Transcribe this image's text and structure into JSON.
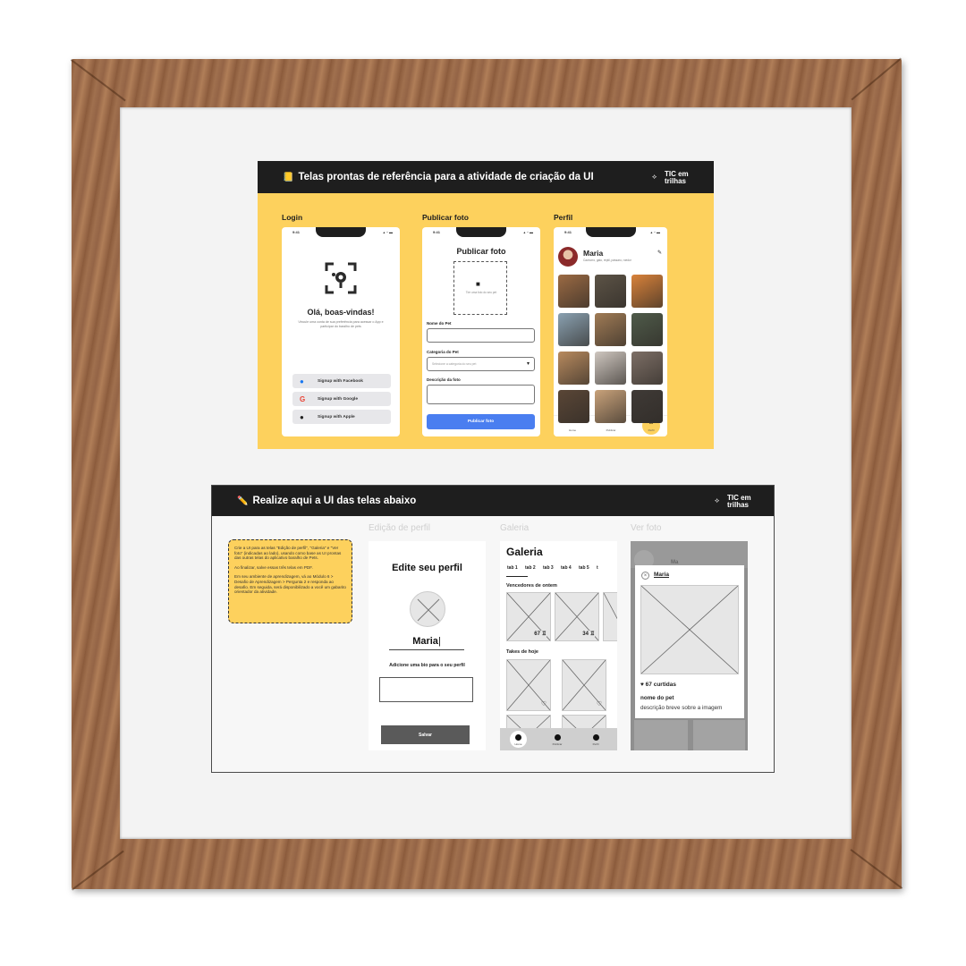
{
  "reference_panel": {
    "title": "Telas prontas de referência para a atividade de criação da UI",
    "title_icon": "📒",
    "brand": [
      "TIC em",
      "trilhas"
    ],
    "colors": {
      "accent": "#fdd15d",
      "header": "#1e1e1e",
      "primary_button": "#4a7ef0"
    },
    "screens": {
      "login": {
        "label": "Login",
        "time": "9:41",
        "heading": "Olá, boas-vindas!",
        "subtitle": "Vincule uma conta de sua preferência para acessar o App e participar do baralho de pets",
        "buttons": [
          {
            "label": "Signup with Facebook",
            "icon": "facebook-icon"
          },
          {
            "label": "Signup with Google",
            "icon": "google-icon"
          },
          {
            "label": "Signup with Apple",
            "icon": "apple-icon"
          }
        ]
      },
      "publish": {
        "label": "Publicar foto",
        "time": "9:41",
        "heading": "Publicar foto",
        "upload_hint": "Tire uma foto do seu pet",
        "pet_name_label": "Nome do Pet",
        "category_label": "Categoria do Pet",
        "category_placeholder": "Selecione a categoria do seu pet",
        "description_label": "Descrição da foto",
        "submit": "Publicar foto"
      },
      "profile": {
        "label": "Perfil",
        "time": "9:41",
        "name": "Maria",
        "tags": "Cachorro, gato, réptil, pássaro, roedor",
        "photo_colors": [
          "#9b6a43",
          "#5c5346",
          "#d9823a",
          "#8aa1b1",
          "#a07b55",
          "#4f5b4a",
          "#b88a5e",
          "#cfc7c0",
          "#7d6f66",
          "#5a4636",
          "#c9a27a",
          "#3f3a36"
        ],
        "nav": [
          "Home",
          "Publicar",
          "Perfil"
        ]
      }
    }
  },
  "task_panel": {
    "title": "Realize aqui a UI das telas abaixo",
    "title_icon": "✏️",
    "brand": [
      "TIC em",
      "trilhas"
    ],
    "instructions": [
      "Crie a UI para as telas \"Edição de perfil\", \"Galeria\" e \"Ver foto\" (indicadas ao lado), usando como base as UI prontas das outras telas do aplicativo baralho de Pets.",
      "Ao finalizar, salve essas três telas em PDF.",
      "Em seu ambiente de aprendizagem, vá ao Módulo 6 > Desafio de Aprendizagem > Pergunta 2 e responda ao desafio. Em seguida, será disponibilizado a você um gabarito orientador da atividade."
    ],
    "edit_profile": {
      "label": "Edição de perfil",
      "heading": "Edite seu perfil",
      "name": "Maria",
      "bio_label": "Adicione uma bio para o seu perfil",
      "save": "Salvar"
    },
    "gallery": {
      "label": "Galeria",
      "heading": "Galeria",
      "tabs": [
        "tab 1",
        "tab 2",
        "tab 3",
        "tab 4",
        "tab 5",
        "t"
      ],
      "section1": "Vencedores de ontem",
      "votes": [
        "67",
        "34"
      ],
      "section2": "Takes de hoje",
      "nav": [
        "Home",
        "Publicar",
        "Perfil"
      ]
    },
    "view_photo": {
      "label": "Ver foto",
      "username": "Maria",
      "likes": "67 curtidas",
      "pet_name": "nome do pet",
      "description": "descrição breve sobre a imagem",
      "behind_text": "Ma"
    }
  }
}
